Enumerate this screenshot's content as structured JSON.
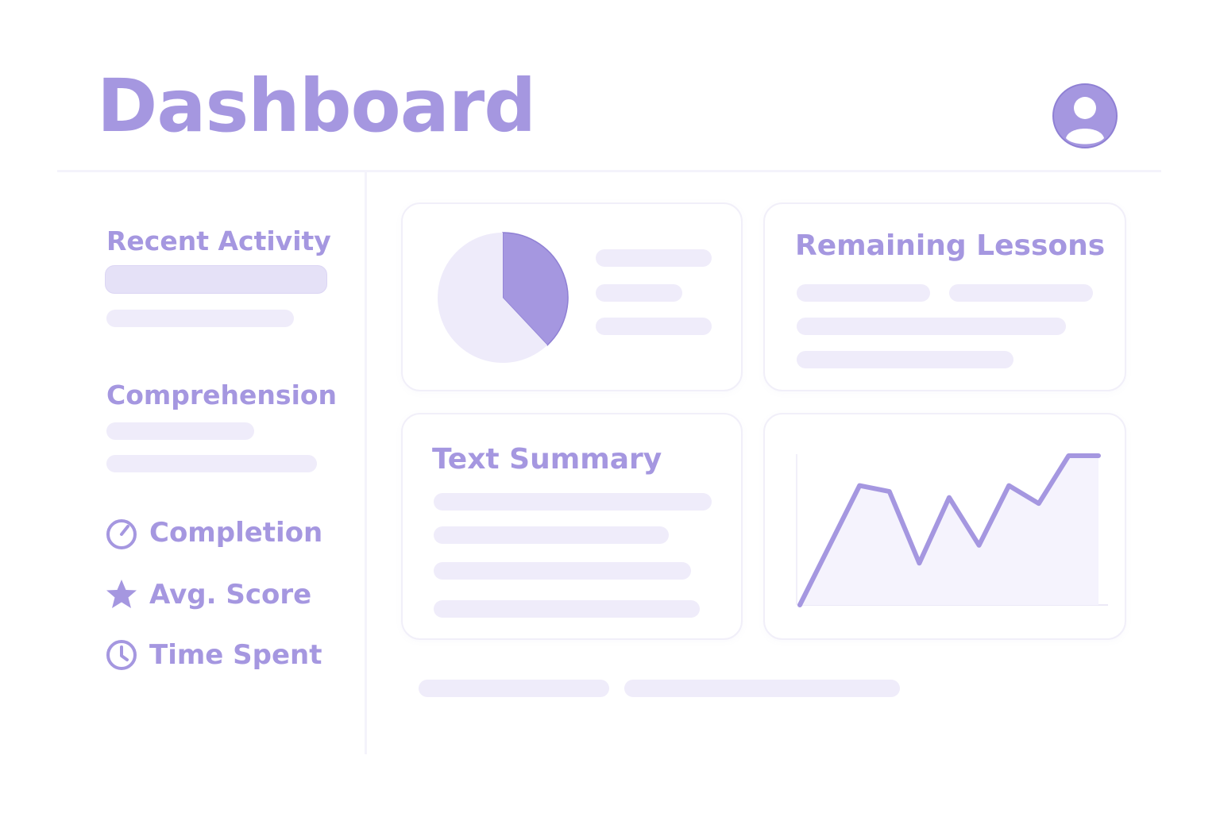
{
  "header": {
    "title": "Dashboard",
    "avatar_icon": "user-avatar-icon"
  },
  "sidebar": {
    "recent_activity": "Recent Activity",
    "comprehension": "Comprehension",
    "metrics": [
      {
        "label": "Completion",
        "icon": "gauge-icon"
      },
      {
        "label": "Avg. Score",
        "icon": "star-icon"
      },
      {
        "label": "Time Spent",
        "icon": "clock-icon"
      }
    ]
  },
  "cards": {
    "remaining_lessons": "Remaining Lessons",
    "text_summary": "Text Summary"
  },
  "colors": {
    "accent": "#a597e0",
    "placeholder": "#efecfa",
    "pie_light": "#eeebfa"
  },
  "chart_data": [
    {
      "type": "pie",
      "values": [
        38,
        62
      ]
    },
    {
      "type": "area",
      "x": [
        0,
        1,
        2,
        3,
        4,
        5,
        6,
        7,
        8,
        9,
        10
      ],
      "values": [
        0,
        20,
        40,
        38,
        14,
        36,
        20,
        40,
        34,
        50,
        50
      ],
      "grid": false
    }
  ]
}
